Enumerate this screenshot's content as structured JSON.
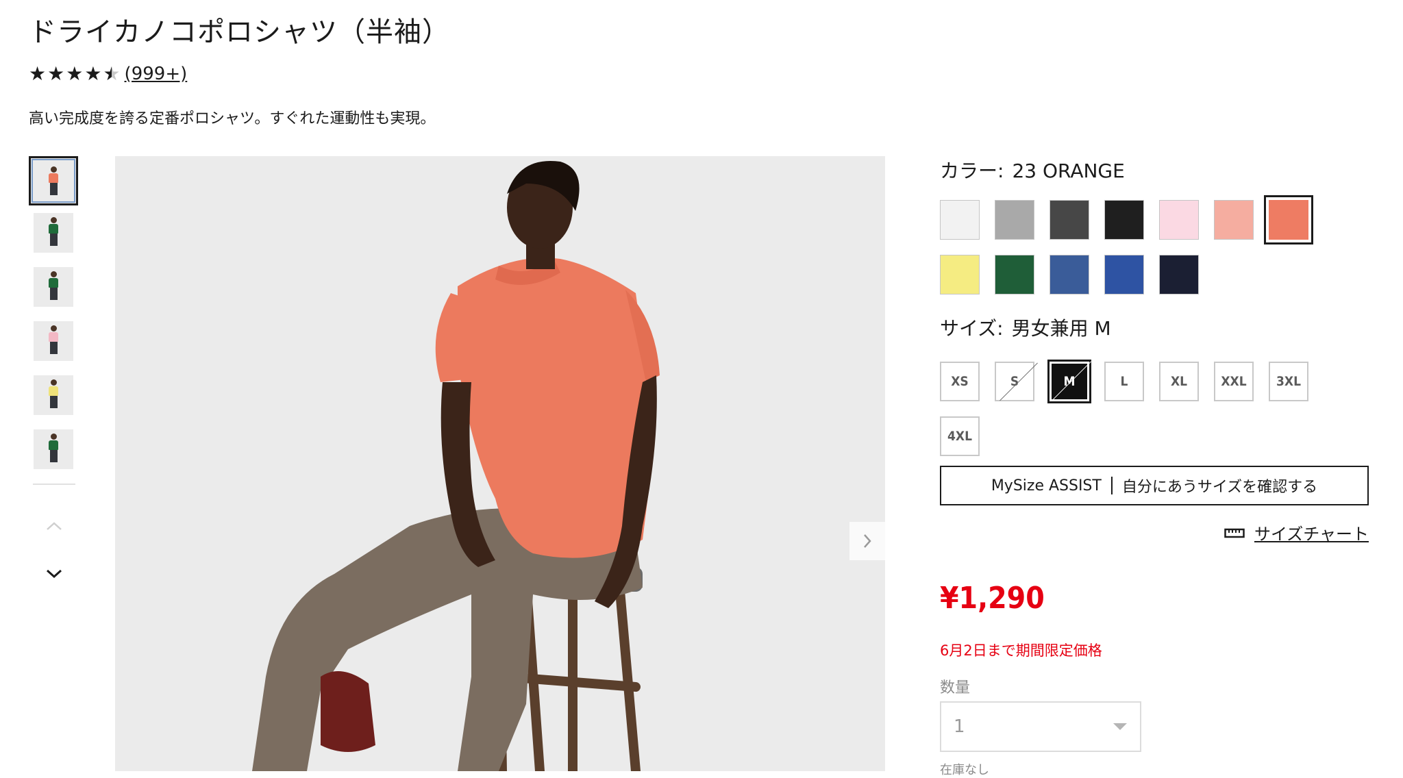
{
  "product": {
    "title": "ドライカノコポロシャツ（半袖）",
    "review_count": "(999+)",
    "rating": 4.5,
    "description": "高い完成度を誇る定番ポロシャツ。すぐれた運動性も実現。"
  },
  "gallery": {
    "thumbnails": [
      {
        "name": "orange seated",
        "color": "#ec7a5e"
      },
      {
        "name": "green standing",
        "color": "#1f6b3a"
      },
      {
        "name": "green close",
        "color": "#1f6b3a"
      },
      {
        "name": "pink standing",
        "color": "#f3b8c4"
      },
      {
        "name": "yellow standing",
        "color": "#efe27a"
      },
      {
        "name": "green standing 2",
        "color": "#1f6b3a"
      }
    ],
    "arrow_up_icon": "chevron-up-icon",
    "arrow_down_icon": "chevron-down-icon",
    "next_icon": "chevron-right-icon"
  },
  "color": {
    "label": "カラー:",
    "selected": "23 ORANGE",
    "swatches": [
      {
        "hex": "#f2f2f2"
      },
      {
        "hex": "#a9a9a9"
      },
      {
        "hex": "#474747"
      },
      {
        "hex": "#1f1f1f"
      },
      {
        "hex": "#fbd9e3"
      },
      {
        "hex": "#f5ada0"
      },
      {
        "hex": "#ee7c63",
        "selected": true
      },
      {
        "hex": "#f5ec82"
      },
      {
        "hex": "#1f5e38"
      },
      {
        "hex": "#3a5c99"
      },
      {
        "hex": "#2e53a3"
      },
      {
        "hex": "#1b1f33"
      }
    ]
  },
  "size": {
    "label": "サイズ:",
    "selected": "男女兼用 M",
    "options": [
      {
        "label": "XS"
      },
      {
        "label": "S",
        "unavailable": true
      },
      {
        "label": "M",
        "selected": true,
        "unavailable": true
      },
      {
        "label": "L"
      },
      {
        "label": "XL"
      },
      {
        "label": "XXL"
      },
      {
        "label": "3XL"
      },
      {
        "label": "4XL"
      }
    ]
  },
  "mysize": {
    "brand": "MySize ASSIST",
    "text": "自分にあうサイズを確認する"
  },
  "size_chart": {
    "label": "サイズチャート",
    "icon": "ruler-icon"
  },
  "price": {
    "value": "¥1,290",
    "note": "6月2日まで期間限定価格",
    "accent": "#e60012"
  },
  "quantity": {
    "label": "数量",
    "value": "1",
    "stock": "在庫なし"
  }
}
